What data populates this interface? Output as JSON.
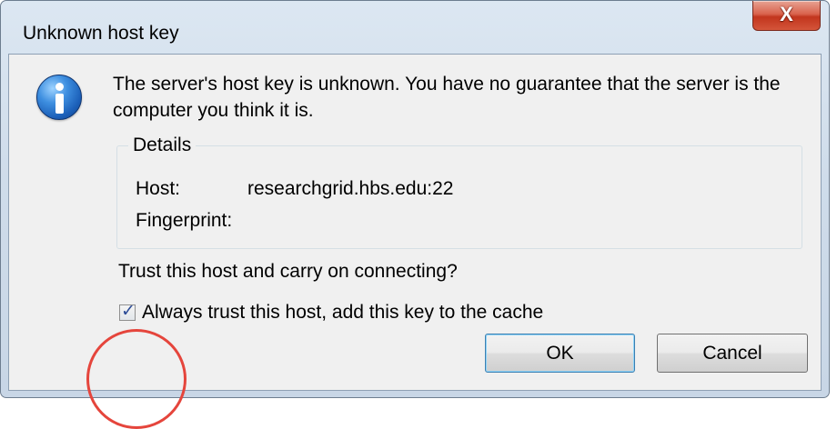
{
  "window": {
    "title": "Unknown host key",
    "close_glyph": "X"
  },
  "message": "The server's host key is unknown. You have no guarantee that the server is the computer you think it is.",
  "details": {
    "legend": "Details",
    "host_label": "Host:",
    "host_value": "researchgrid.hbs.edu:22",
    "fingerprint_label": "Fingerprint:",
    "fingerprint_value": ""
  },
  "question": "Trust this host and carry on connecting?",
  "checkbox": {
    "label": "Always trust this host, add this key to the cache",
    "checked": true,
    "check_glyph": "✓"
  },
  "buttons": {
    "ok": "OK",
    "cancel": "Cancel"
  },
  "icons": {
    "dialog_icon": "information-icon",
    "close_icon": "close-icon"
  },
  "colors": {
    "annotation": "#e5453c",
    "close_button": "#c2351d",
    "info_icon": "#1b5fb8"
  }
}
